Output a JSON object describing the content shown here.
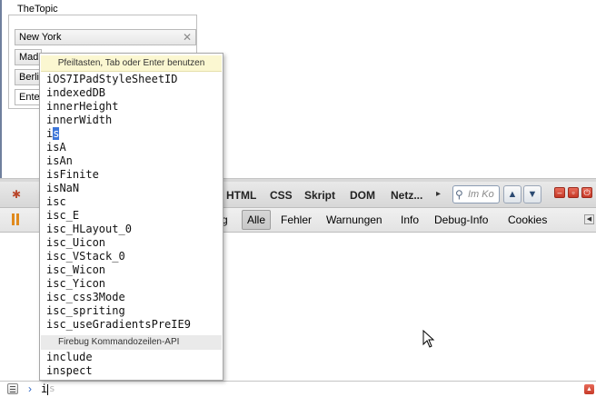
{
  "page": {
    "fieldset_legend": "TheTopic",
    "tags": [
      "New York",
      "Madrid",
      "Berlin",
      "Enter"
    ]
  },
  "firebug": {
    "tabs": [
      "HTML",
      "CSS",
      "Skript",
      "DOM",
      "Netz..."
    ],
    "search_placeholder": "Im Ko",
    "filters": [
      "Alle",
      "Fehler",
      "Warnungen",
      "Info",
      "Debug-Info",
      "Cookies"
    ],
    "active_filter": "Alle",
    "partial_filter_tail": "g"
  },
  "autocomplete": {
    "hint": "Pfeiltasten, Tab oder Enter benutzen",
    "items": [
      "iOS7IPadStyleSheetID",
      "indexedDB",
      "innerHeight",
      "innerWidth",
      "is",
      "isA",
      "isAn",
      "isFinite",
      "isNaN",
      "isc",
      "isc_E",
      "isc_HLayout_0",
      "isc_Uicon",
      "isc_VStack_0",
      "isc_Wicon",
      "isc_Yicon",
      "isc_css3Mode",
      "isc_spriting",
      "isc_useGradientsPreIE9"
    ],
    "selected_item": "is",
    "section_label": "Firebug Kommandozeilen-API",
    "api_items": [
      "include",
      "inspect"
    ]
  },
  "command_line": {
    "prompt": "›",
    "typed": "i",
    "ghost_completion": "s"
  },
  "icons": {
    "bug": "firebug-icon",
    "pause": "pause-on-error-icon",
    "search": "magnifier-icon",
    "prev": "chevron-up-icon",
    "next": "chevron-down-icon",
    "minimize": "minimize-icon",
    "detach": "detach-icon",
    "close": "power-close-icon",
    "cmd_menu": "menu-list-icon",
    "expand": "expand-icon"
  },
  "colors": {
    "selection": "#3d76d9",
    "hint_bg": "#fbf7d1",
    "window_button": "#c63a28"
  }
}
